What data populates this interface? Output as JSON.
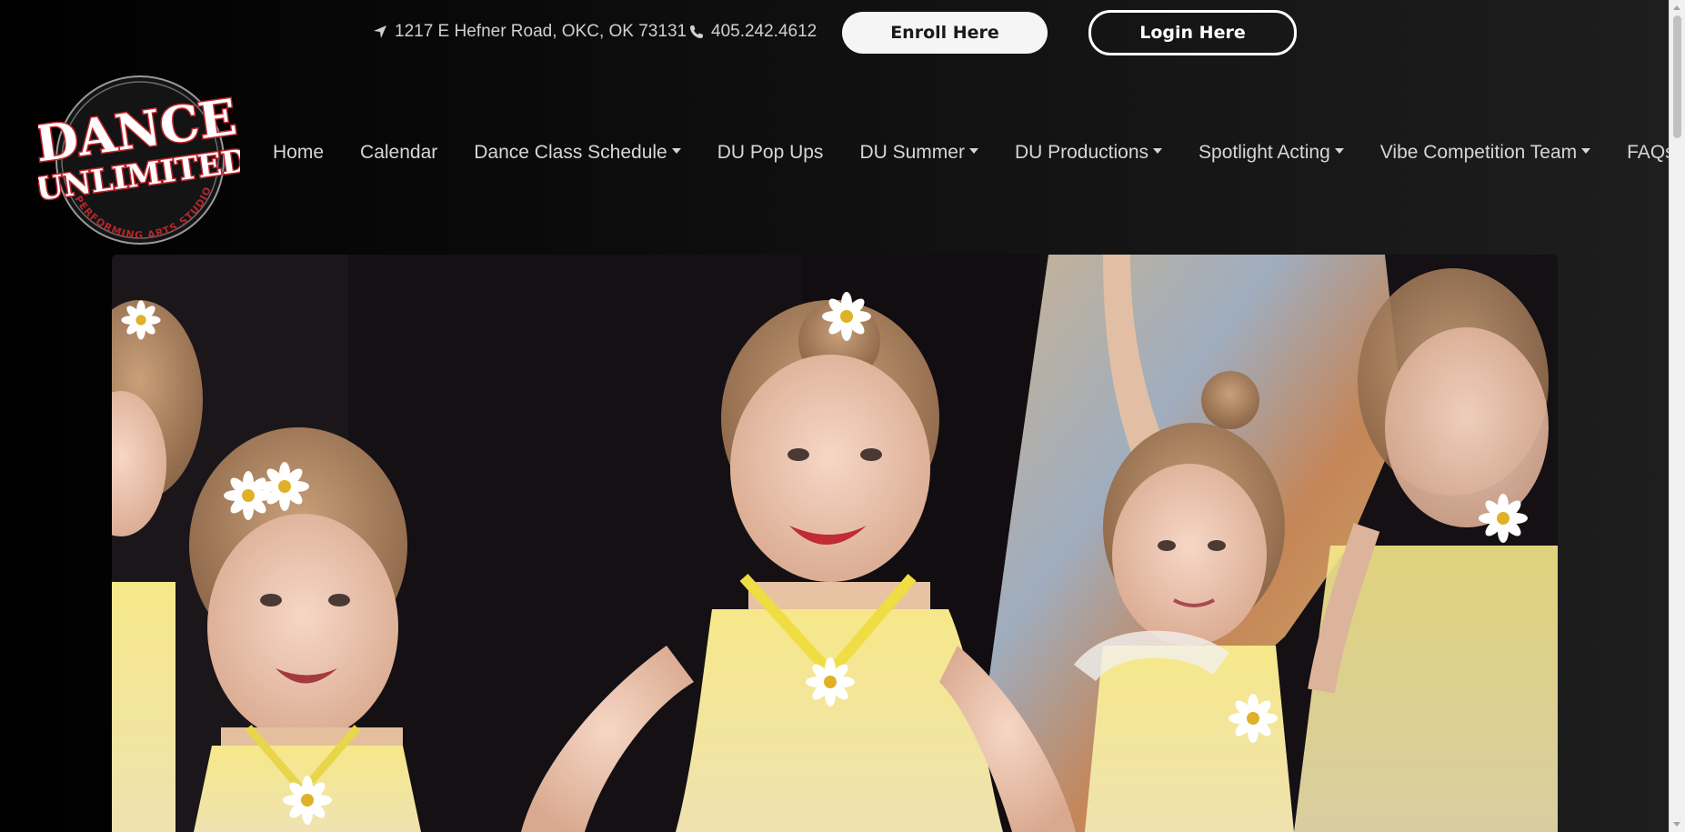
{
  "topbar": {
    "address": "1217 E Hefner Road, OKC, OK 73131",
    "phone": "405.242.4612",
    "enroll_label": "Enroll Here",
    "login_label": "Login Here"
  },
  "logo": {
    "line1": "DANCE",
    "line2": "UNLIMITED",
    "tagline": "PERFORMING ARTS STUDIO"
  },
  "nav": {
    "items": [
      {
        "label": "Home",
        "dropdown": false
      },
      {
        "label": "Calendar",
        "dropdown": false
      },
      {
        "label": "Dance Class Schedule",
        "dropdown": true
      },
      {
        "label": "DU Pop Ups",
        "dropdown": false
      },
      {
        "label": "DU Summer",
        "dropdown": true
      },
      {
        "label": "DU Productions",
        "dropdown": true
      },
      {
        "label": "Spotlight Acting",
        "dropdown": true
      },
      {
        "label": "Vibe Competition Team",
        "dropdown": true
      },
      {
        "label": "FAQs",
        "dropdown": true
      }
    ]
  },
  "icons": {
    "address": "location-arrow-icon",
    "phone": "phone-icon"
  },
  "colors": {
    "background": "#000000",
    "enroll_bg": "#f5f5f5",
    "costume_yellow": "#f3e27a"
  }
}
